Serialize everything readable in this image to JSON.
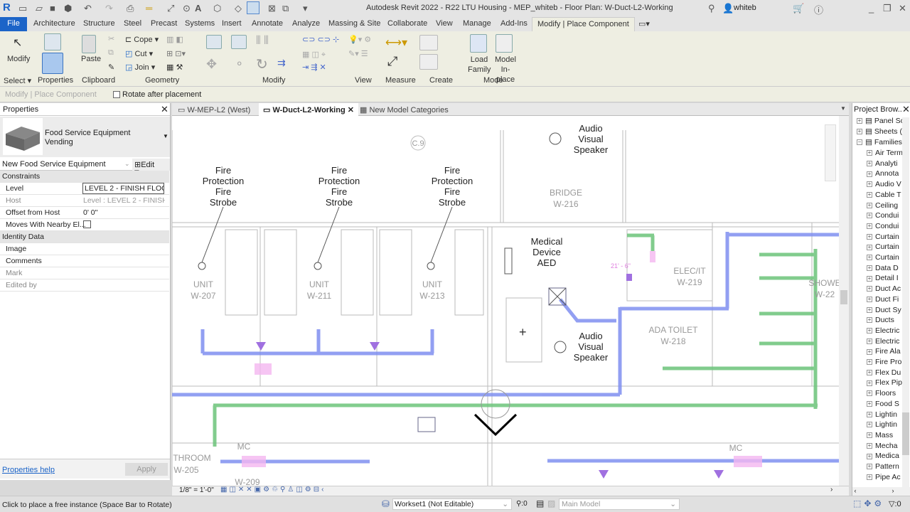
{
  "title": "Autodesk Revit 2022 - R22 LTU Housing - MEP_whiteb - Floor Plan: W-Duct-L2-Working",
  "user": "whiteb",
  "tabs": [
    "File",
    "Architecture",
    "Structure",
    "Steel",
    "Precast",
    "Systems",
    "Insert",
    "Annotate",
    "Analyze",
    "Massing & Site",
    "Collaborate",
    "View",
    "Manage",
    "Add-Ins",
    "Modify | Place Component"
  ],
  "ribbon": {
    "modify": "Modify",
    "select": "Select",
    "properties": "Properties",
    "paste": "Paste",
    "clipboard": "Clipboard",
    "cope": "Cope",
    "cut": "Cut",
    "join": "Join",
    "geometry": "Geometry",
    "modify_panel": "Modify",
    "view": "View",
    "measure": "Measure",
    "create": "Create",
    "load_family": "Load Family",
    "model_inplace": "Model In-place",
    "mode": "Mode"
  },
  "options": {
    "context": "Modify | Place Component",
    "rotate": "Rotate after placement"
  },
  "properties": {
    "title": "Properties",
    "family": "Food Service Equipment",
    "type": "Vending",
    "selector": "New Food Service Equipment",
    "edit_type": "Edit Type",
    "groups": {
      "constraints": "Constraints",
      "identity": "Identity Data"
    },
    "rows": [
      {
        "k": "Level",
        "v": "LEVEL 2 - FINISH FLOC"
      },
      {
        "k": "Host",
        "v": "Level : LEVEL 2 - FINISH..."
      },
      {
        "k": "Offset from Host",
        "v": "0'  0\""
      },
      {
        "k": "Moves With Nearby El...",
        "v": ""
      },
      {
        "k": "Image",
        "v": ""
      },
      {
        "k": "Comments",
        "v": ""
      },
      {
        "k": "Mark",
        "v": ""
      },
      {
        "k": "Edited by",
        "v": ""
      }
    ],
    "help": "Properties help",
    "apply": "Apply"
  },
  "view_tabs": [
    "W-MEP-L2 (West)",
    "W-Duct-L2-Working",
    "New Model Categories"
  ],
  "canvas": {
    "grid": "C.9",
    "labels": {
      "avs": [
        "Audio",
        "Visual",
        "Speaker"
      ],
      "fps": [
        "Fire",
        "Protection",
        "Fire",
        "Strobe"
      ],
      "aed": [
        "Medical",
        "Device",
        "AED"
      ]
    },
    "rooms": [
      [
        "BRIDGE",
        "W-216"
      ],
      [
        "UNIT",
        "W-207"
      ],
      [
        "UNIT",
        "W-211"
      ],
      [
        "UNIT",
        "W-213"
      ],
      [
        "ELEC/IT",
        "W-219"
      ],
      [
        "SHOWE",
        "W-22"
      ],
      [
        "ADA TOILET",
        "W-218"
      ],
      [
        "THROOM",
        "W-205"
      ],
      [
        "MC",
        "W-209"
      ],
      [
        "MC",
        ""
      ]
    ],
    "dimension": "21' - 6\""
  },
  "view_scale": "1/8\" = 1'-0\"",
  "browser": {
    "title": "Project Brow...",
    "top": [
      "Panel Sc",
      "Sheets (",
      "Families"
    ],
    "items": [
      "Air Term",
      "Analyti",
      "Annota",
      "Audio V",
      "Cable T",
      "Ceiling",
      "Condui",
      "Condui",
      "Curtain",
      "Curtain",
      "Curtain",
      "Data D",
      "Detail I",
      "Duct Ac",
      "Duct Fi",
      "Duct Sy",
      "Ducts",
      "Electric",
      "Electric",
      "Fire Ala",
      "Fire Pro",
      "Flex Du",
      "Flex Pip",
      "Floors",
      "Food S",
      "Lightin",
      "Lightin",
      "Mass",
      "Mecha",
      "Medica",
      "Pattern",
      "Pipe Ac"
    ]
  },
  "status": {
    "message": "Click to place a free instance (Space Bar to Rotate)",
    "workset": "Workset1 (Not Editable)",
    "count": ":0",
    "model": "Main Model",
    "filter": ":0"
  },
  "colors": {
    "duct": "#7f8ff0",
    "pipe": "#6cc47a",
    "accent": "#1c64c8"
  }
}
